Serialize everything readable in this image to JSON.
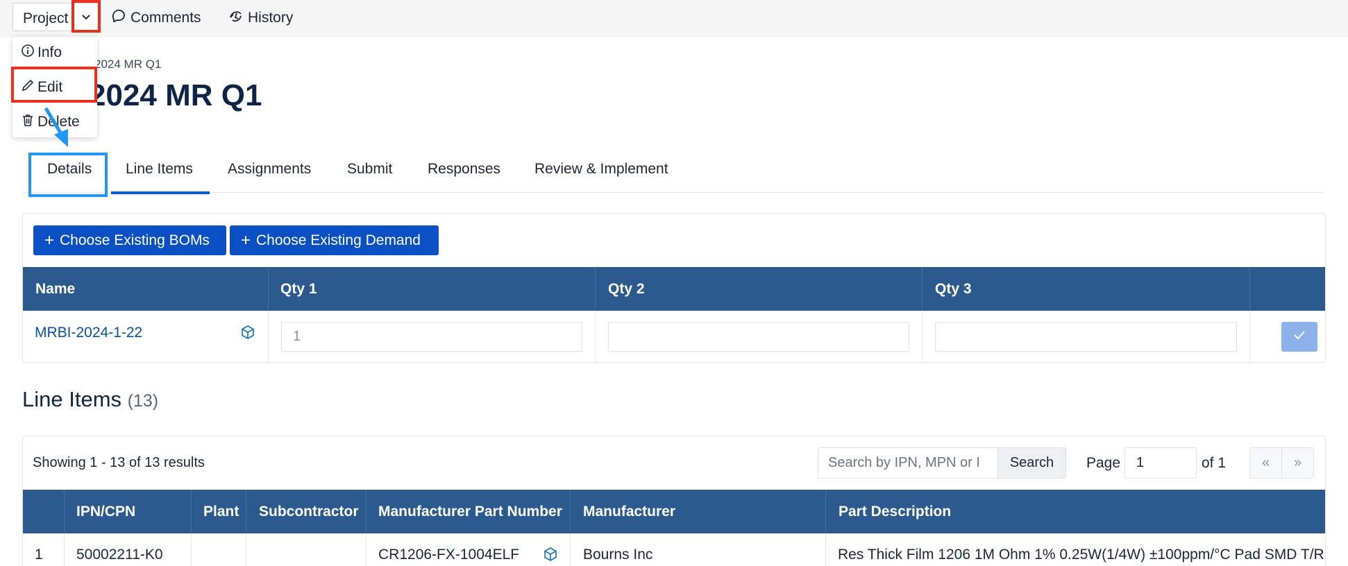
{
  "toolbar": {
    "project_label": "Project",
    "comments_label": "Comments",
    "history_label": "History"
  },
  "menu": {
    "info_label": "Info",
    "edit_label": "Edit",
    "delete_label": "Delete"
  },
  "header": {
    "breadcrumb": "2024 MR Q1",
    "title": "2024 MR Q1"
  },
  "tabs": [
    {
      "label": "Details"
    },
    {
      "label": "Line Items"
    },
    {
      "label": "Assignments"
    },
    {
      "label": "Submit"
    },
    {
      "label": "Responses"
    },
    {
      "label": "Review & Implement"
    }
  ],
  "bom": {
    "choose_boms_label": "Choose Existing BOMs",
    "choose_demand_label": "Choose Existing Demand",
    "columns": [
      "Name",
      "Qty 1",
      "Qty 2",
      "Qty 3"
    ],
    "row": {
      "name": "MRBI-2024-1-22",
      "qty1_placeholder": "1",
      "qty2": "",
      "qty3": ""
    }
  },
  "line_items": {
    "title": "Line Items",
    "count": "(13)",
    "showing": "Showing 1 - 13 of 13 results",
    "search_placeholder": "Search by IPN, MPN or I",
    "search_label": "Search",
    "page_label": "Page",
    "page_value": "1",
    "of_label": "of 1",
    "prev_label": "«",
    "next_label": "»",
    "columns": [
      "IPN/CPN",
      "Plant",
      "Subcontractor",
      "Manufacturer Part Number",
      "Manufacturer",
      "Part Description"
    ],
    "rows": [
      {
        "index": "1",
        "ipn": "50002211-K0",
        "plant": "",
        "subcontractor": "",
        "mpn": "CR1206-FX-1004ELF",
        "manufacturer": "Bourns Inc",
        "description": "Res Thick Film 1206 1M Ohm 1% 0.25W(1/4W) ±100ppm/°C Pad SMD T/R"
      }
    ]
  },
  "colors": {
    "primary": "#0b4fc4",
    "table_header": "#2d5a8e",
    "annotation_red": "#e8321e",
    "annotation_blue": "#2196f3"
  }
}
